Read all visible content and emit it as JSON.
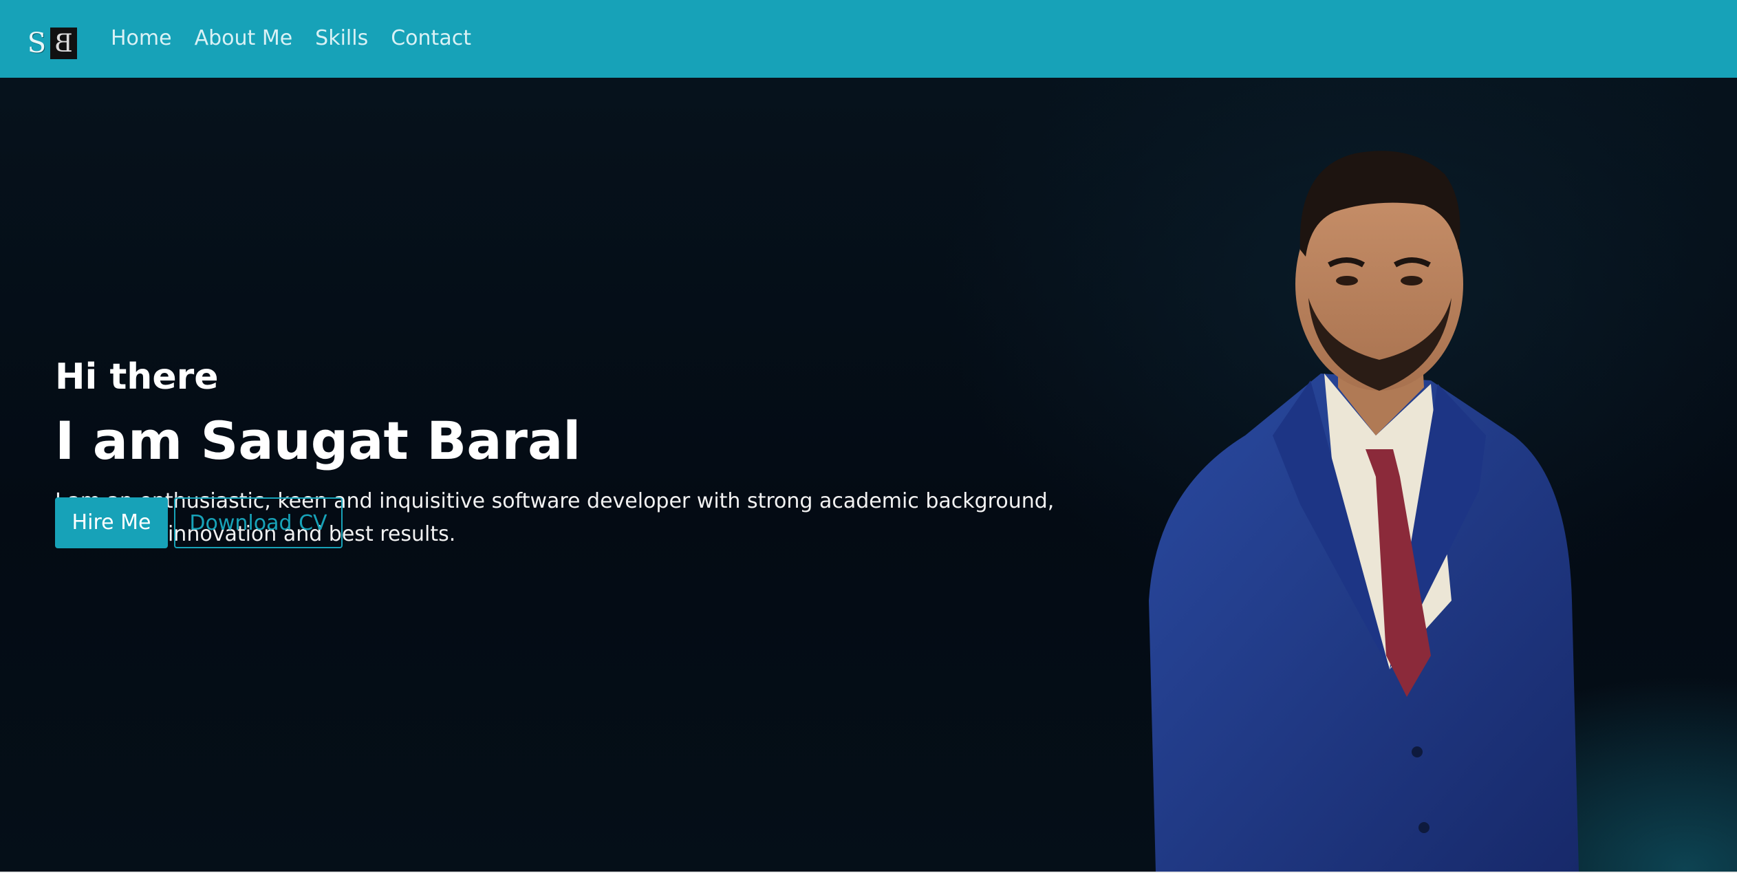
{
  "nav": {
    "logo_left": "S",
    "logo_right": "B",
    "items": [
      {
        "label": "Home"
      },
      {
        "label": "About Me"
      },
      {
        "label": "Skills"
      },
      {
        "label": "Contact"
      }
    ]
  },
  "hero": {
    "greeting": "Hi there",
    "name": "I am Saugat Baral",
    "intro": "I am an enthusiastic, keen and inquisitive software developer with strong academic background, focused in innovation and best results.",
    "hire_label": "Hire Me",
    "cv_label": "Download CV"
  },
  "colors": {
    "accent": "#17a2b8",
    "hero_bg": "#06121c",
    "suit": "#1f3a8a",
    "tie": "#8b2a3a"
  }
}
